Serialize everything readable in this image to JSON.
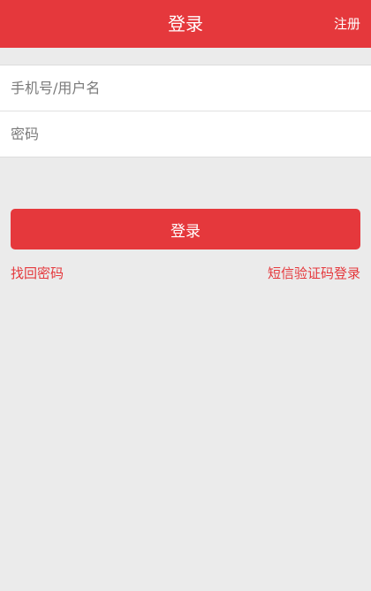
{
  "header": {
    "title": "登录",
    "register_label": "注册"
  },
  "form": {
    "username_placeholder": "手机号/用户名",
    "password_placeholder": "密码"
  },
  "actions": {
    "login_label": "登录",
    "forgot_password_label": "找回密码",
    "sms_login_label": "短信验证码登录"
  },
  "colors": {
    "accent": "#e5383c",
    "background": "#ebebeb"
  }
}
